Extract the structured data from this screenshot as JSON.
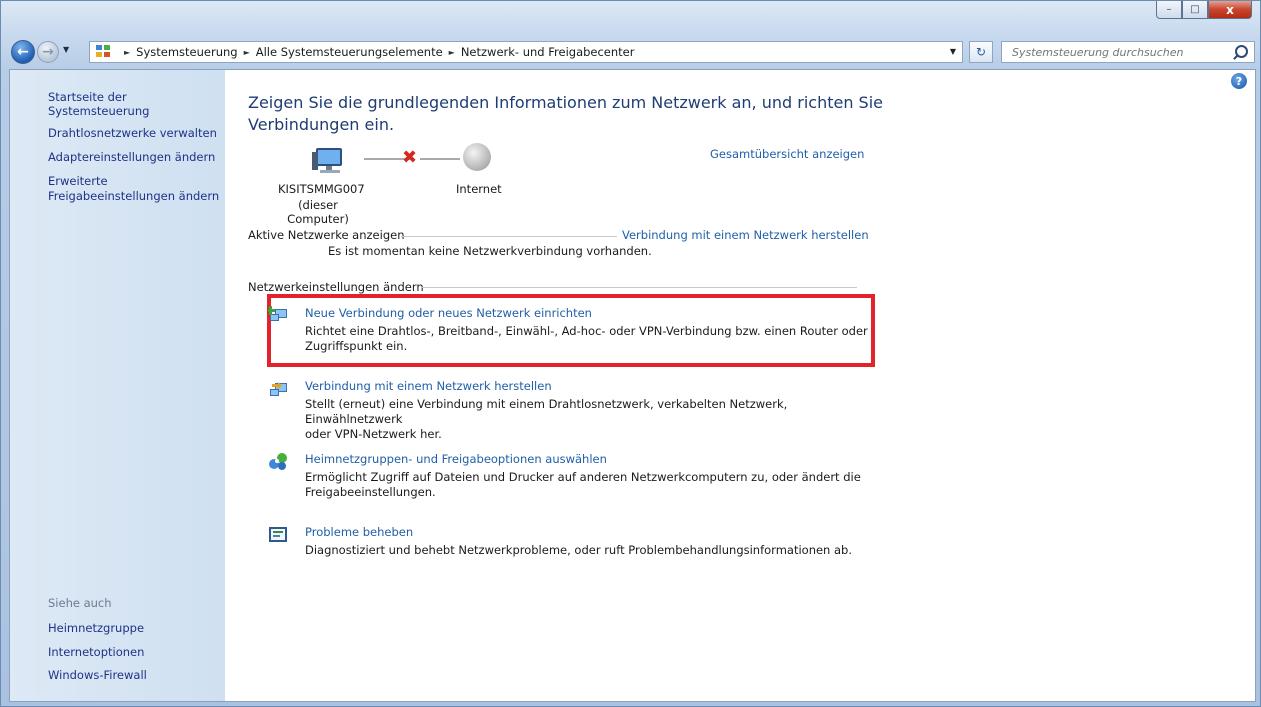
{
  "window": {
    "caption_buttons": {
      "minimize": "–",
      "maximize": "□",
      "close": "x"
    }
  },
  "nav": {
    "breadcrumbs": [
      "Systemsteuerung",
      "Alle Systemsteuerungselemente",
      "Netzwerk- und Freigabecenter"
    ],
    "search_placeholder": "Systemsteuerung durchsuchen"
  },
  "sidebar": {
    "links": [
      "Startseite der Systemsteuerung",
      "Drahtlosnetzwerke verwalten",
      "Adaptereinstellungen ändern",
      "Erweiterte",
      "Freigabeeinstellungen ändern"
    ],
    "see_also_heading": "Siehe auch",
    "see_also": [
      "Heimnetzgruppe",
      "Internetoptionen",
      "Windows-Firewall"
    ]
  },
  "main": {
    "title_line1": "Zeigen Sie die grundlegenden Informationen zum Netzwerk an, und richten Sie",
    "title_line2": "Verbindungen ein.",
    "overview_link": "Gesamtübersicht anzeigen",
    "computer_name": "KISITSMMG007",
    "computer_sub": "(dieser Computer)",
    "internet_label": "Internet",
    "active_networks_label": "Aktive Netzwerke anzeigen",
    "connect_link": "Verbindung mit einem Netzwerk herstellen",
    "no_connection": "Es ist momentan keine Netzwerkverbindung vorhanden.",
    "change_settings_label": "Netzwerkeinstellungen ändern",
    "tasks": [
      {
        "title": "Neue Verbindung oder neues Netzwerk einrichten",
        "desc1": "Richtet eine Drahtlos-, Breitband-, Einwähl-, Ad-hoc- oder VPN-Verbindung bzw. einen Router oder",
        "desc2": "Zugriffspunkt ein."
      },
      {
        "title": "Verbindung mit einem Netzwerk herstellen",
        "desc1": "Stellt (erneut) eine Verbindung mit einem Drahtlosnetzwerk, verkabelten Netzwerk, Einwählnetzwerk",
        "desc2": "oder VPN-Netzwerk her."
      },
      {
        "title": "Heimnetzgruppen- und Freigabeoptionen auswählen",
        "desc1": "Ermöglicht Zugriff auf Dateien und Drucker auf anderen Netzwerkcomputern zu, oder ändert die",
        "desc2": "Freigabeeinstellungen."
      },
      {
        "title": "Probleme beheben",
        "desc1": "Diagnostiziert und behebt Netzwerkprobleme, oder ruft Problembehandlungsinformationen ab.",
        "desc2": ""
      }
    ]
  },
  "colors": {
    "link": "#1f5fa8",
    "title": "#1e3d74",
    "highlight": "#e3232c"
  }
}
